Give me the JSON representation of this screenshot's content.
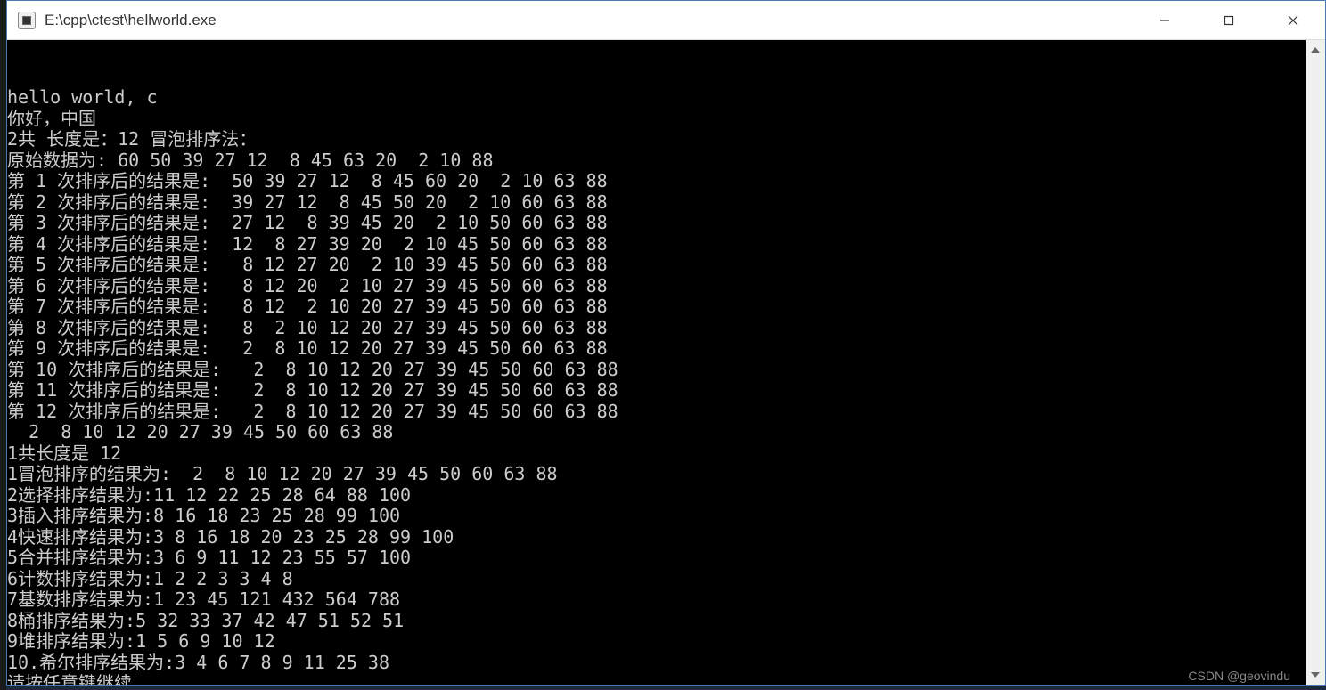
{
  "window": {
    "title": "E:\\cpp\\ctest\\hellworld.exe"
  },
  "console": {
    "lines": [
      "hello world, c",
      "你好，中国",
      "2共 长度是：12 冒泡排序法：",
      "原始数据为: 60 50 39 27 12  8 45 63 20  2 10 88",
      "第 1 次排序后的结果是:  50 39 27 12  8 45 60 20  2 10 63 88",
      "第 2 次排序后的结果是:  39 27 12  8 45 50 20  2 10 60 63 88",
      "第 3 次排序后的结果是:  27 12  8 39 45 20  2 10 50 60 63 88",
      "第 4 次排序后的结果是:  12  8 27 39 20  2 10 45 50 60 63 88",
      "第 5 次排序后的结果是:   8 12 27 20  2 10 39 45 50 60 63 88",
      "第 6 次排序后的结果是:   8 12 20  2 10 27 39 45 50 60 63 88",
      "第 7 次排序后的结果是:   8 12  2 10 20 27 39 45 50 60 63 88",
      "第 8 次排序后的结果是:   8  2 10 12 20 27 39 45 50 60 63 88",
      "第 9 次排序后的结果是:   2  8 10 12 20 27 39 45 50 60 63 88",
      "第 10 次排序后的结果是:   2  8 10 12 20 27 39 45 50 60 63 88",
      "第 11 次排序后的结果是:   2  8 10 12 20 27 39 45 50 60 63 88",
      "第 12 次排序后的结果是:   2  8 10 12 20 27 39 45 50 60 63 88",
      "  2  8 10 12 20 27 39 45 50 60 63 88",
      "1共长度是 12",
      "1冒泡排序的结果为:  2  8 10 12 20 27 39 45 50 60 63 88",
      "2选择排序结果为:11 12 22 25 28 64 88 100",
      "3插入排序结果为:8 16 18 23 25 28 99 100",
      "4快速排序结果为:3 8 16 18 20 23 25 28 99 100",
      "5合并排序结果为:3 6 9 11 12 23 55 57 100",
      "6计数排序结果为:1 2 2 3 3 4 8",
      "7基数排序结果为:1 23 45 121 432 564 788",
      "8桶排序结果为:5 32 33 37 42 47 51 52 51",
      "9堆排序结果为:1 5 6 9 10 12",
      "10.希尔排序结果为:3 4 6 7 8 9 11 25 38",
      "请按任意键继续. . ."
    ]
  },
  "watermark": "CSDN @geovindu"
}
